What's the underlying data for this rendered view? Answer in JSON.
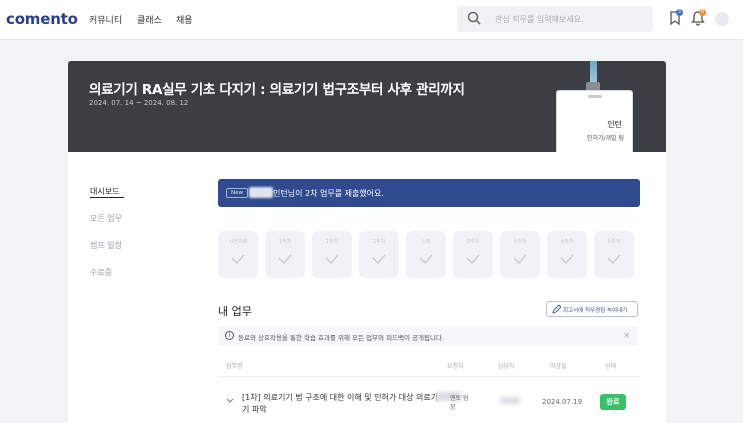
{
  "nav": {
    "logo": "comento",
    "links": [
      "커뮤니티",
      "클래스",
      "채용"
    ],
    "search_placeholder": "관심 직무를 입력해보세요.",
    "bookmark_badge": "3",
    "bell_badge": "8",
    "colors": {
      "bookmark_badge": "#3b6fe0",
      "bell_badge": "#f08a2b"
    }
  },
  "hero": {
    "title": "의료기기 RA실무 기초 다지기 : 의료기기 법구조부터 사후 관리까지",
    "date_range": "2024. 07. 14 ~ 2024. 08. 12",
    "card_role": "인턴",
    "card_team": "인허가/개발 팀"
  },
  "sidebar": {
    "items": [
      {
        "label": "대시보드",
        "active": true
      },
      {
        "label": "모든 업무",
        "active": false
      },
      {
        "label": "캠프 일정",
        "active": false
      },
      {
        "label": "수료증",
        "active": false
      }
    ]
  },
  "notice": {
    "tag": "New",
    "message": "인턴님이 2차 업무를 제출했어요.",
    "color": "#2f4a8f"
  },
  "steps": [
    "사전과제",
    "1주차",
    "1주차",
    "2주차",
    "신뢰",
    "3주차",
    "3주차",
    "4주차",
    "5주차"
  ],
  "my_tasks": {
    "title": "내 업무",
    "note_button": "회고서에 직무경험 녹여내기",
    "info": "동료와 상호작용을 통한 학습 효과를 위해 모든 업무와 피드백이 공개됩니다.",
    "columns": [
      "업무명",
      "요청자",
      "담당자",
      "마감일",
      "상태"
    ],
    "rows": [
      {
        "name": "[1차] 의료기기 법 구조에 대한 이해 및 인허가 대상 의료기기 파악",
        "requester": "멘토 팀장",
        "due": "2024.07.19",
        "status": "완료",
        "status_color": "#36c26b"
      }
    ]
  }
}
